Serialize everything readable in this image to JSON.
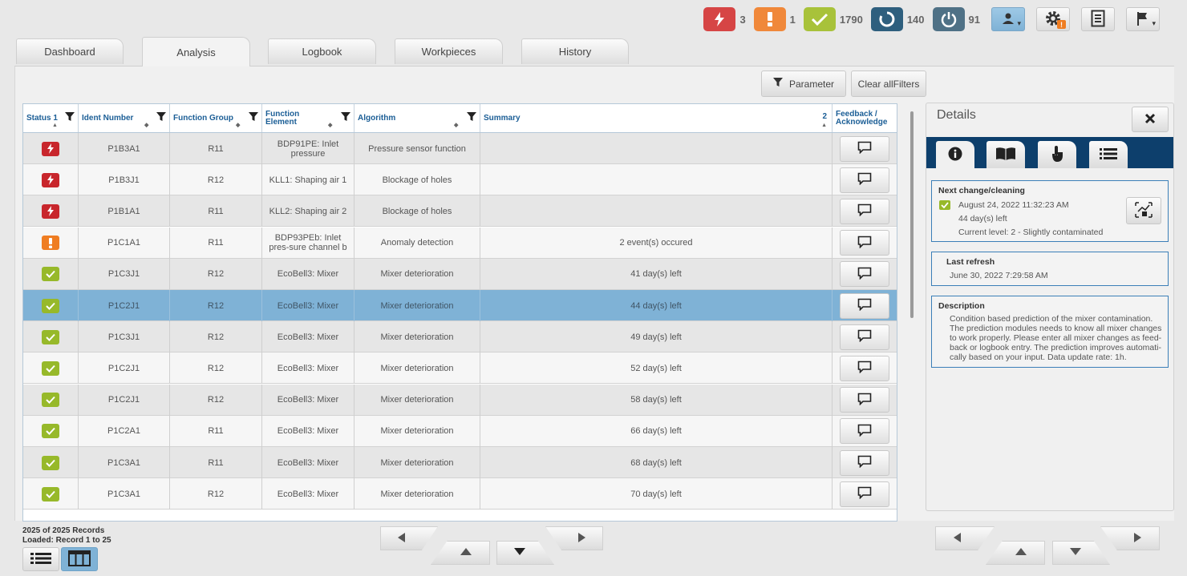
{
  "header": {
    "stats": [
      {
        "name": "error",
        "count": "3",
        "color": "#d64545"
      },
      {
        "name": "warning",
        "count": "1",
        "color": "#f0883a"
      },
      {
        "name": "ok",
        "count": "1790",
        "color": "#a8c23a"
      },
      {
        "name": "running",
        "count": "140",
        "color": "#2e5f7e"
      },
      {
        "name": "off",
        "count": "91",
        "color": "#4f7186"
      }
    ],
    "toolbar_icons": [
      "user-icon",
      "gear-icon",
      "report-icon",
      "flag-icon"
    ]
  },
  "tabs": [
    {
      "label": "Dashboard",
      "active": false
    },
    {
      "label": "Analysis",
      "active": true
    },
    {
      "label": "Logbook",
      "active": false
    },
    {
      "label": "Workpieces",
      "active": false
    },
    {
      "label": "History",
      "active": false
    }
  ],
  "filters": {
    "parameter_label": "Parameter",
    "clear_label": "Clear allFilters"
  },
  "table": {
    "columns": {
      "status": "Status",
      "status_sort": "1",
      "ident": "Ident Number",
      "group": "Function Group",
      "element_1": "Function",
      "element_2": "Element",
      "algorithm": "Algorithm",
      "summary": "Summary",
      "summary_sort": "2",
      "feedback_1": "Feedback /",
      "feedback_2": "Acknowledge"
    },
    "rows": [
      {
        "status": "error",
        "ident": "P1B3A1",
        "group": "R11",
        "element": "BDP91PE: Inlet pressure",
        "algorithm": "Pressure sensor function",
        "summary": ""
      },
      {
        "status": "error",
        "ident": "P1B3J1",
        "group": "R12",
        "element": "KLL1: Shaping air 1",
        "algorithm": "Blockage of holes",
        "summary": ""
      },
      {
        "status": "error",
        "ident": "P1B1A1",
        "group": "R11",
        "element": "KLL2: Shaping air 2",
        "algorithm": "Blockage of holes",
        "summary": ""
      },
      {
        "status": "warning",
        "ident": "P1C1A1",
        "group": "R11",
        "element": "BDP93PEb: Inlet pres-sure channel b",
        "algorithm": "Anomaly detection",
        "summary": "2 event(s) occured"
      },
      {
        "status": "ok",
        "ident": "P1C3J1",
        "group": "R12",
        "element": "EcoBell3: Mixer",
        "algorithm": "Mixer deterioration",
        "summary": "41 day(s) left"
      },
      {
        "status": "ok",
        "ident": "P1C2J1",
        "group": "R12",
        "element": "EcoBell3: Mixer",
        "algorithm": "Mixer deterioration",
        "summary": "44 day(s) left",
        "selected": true
      },
      {
        "status": "ok",
        "ident": "P1C3J1",
        "group": "R12",
        "element": "EcoBell3: Mixer",
        "algorithm": "Mixer deterioration",
        "summary": "49 day(s) left"
      },
      {
        "status": "ok",
        "ident": "P1C2J1",
        "group": "R12",
        "element": "EcoBell3: Mixer",
        "algorithm": "Mixer deterioration",
        "summary": "52 day(s) left"
      },
      {
        "status": "ok",
        "ident": "P1C2J1",
        "group": "R12",
        "element": "EcoBell3: Mixer",
        "algorithm": "Mixer deterioration",
        "summary": "58 day(s) left"
      },
      {
        "status": "ok",
        "ident": "P1C2A1",
        "group": "R11",
        "element": "EcoBell3: Mixer",
        "algorithm": "Mixer deterioration",
        "summary": "66 day(s) left"
      },
      {
        "status": "ok",
        "ident": "P1C3A1",
        "group": "R11",
        "element": "EcoBell3: Mixer",
        "algorithm": "Mixer deterioration",
        "summary": "68 day(s) left"
      },
      {
        "status": "ok",
        "ident": "P1C3A1",
        "group": "R12",
        "element": "EcoBell3: Mixer",
        "algorithm": "Mixer deterioration",
        "summary": "70 day(s) left"
      }
    ]
  },
  "details": {
    "title": "Details",
    "tabs": [
      "info-icon",
      "book-icon",
      "touch-icon",
      "list-icon"
    ],
    "next_change": {
      "title": "Next change/cleaning",
      "date": "August 24, 2022 11:32:23 AM",
      "days_left": "44 day(s) left",
      "level": "Current level: 2 - Slightly contaminated"
    },
    "last_refresh": {
      "title": "Last refresh",
      "date": "June 30, 2022 7:29:58 AM"
    },
    "description": {
      "title": "Description",
      "lines": [
        "Condition based prediction of the mixer contamination.",
        "The prediction modules needs to know all mixer changes",
        "to work properly. Please enter all mixer changes as feed-",
        "back or logbook entry. The prediction improves automati-",
        "cally based on your input. Data update rate: 1h."
      ]
    }
  },
  "footer": {
    "records": "2025 of 2025 Records",
    "loaded": "Loaded: Record 1 to 25"
  },
  "colors": {
    "error": "#c8262c",
    "warning": "#ef7d22",
    "ok": "#97b92a",
    "selected_row": "#7fb2d6",
    "details_tabbar": "#0d3f6c",
    "header_text": "#1b5e96"
  }
}
